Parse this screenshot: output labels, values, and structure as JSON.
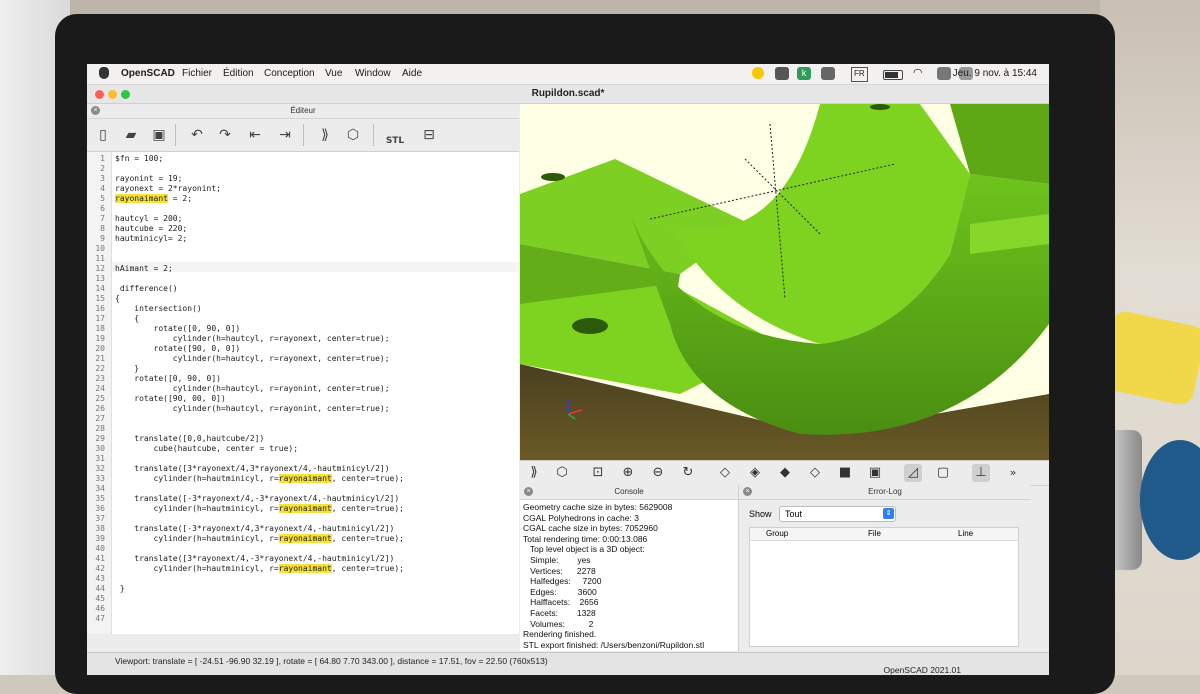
{
  "menubar": {
    "app_name": "OpenSCAD",
    "menus": [
      "Fichier",
      "Édition",
      "Conception",
      "Vue",
      "Window",
      "Aide"
    ],
    "input_source": "FR",
    "clock": "Jeu. 9 nov. à 15:44",
    "tray_icon_k": "k"
  },
  "window": {
    "title": "Rupildon.scad*"
  },
  "editor": {
    "panel_title": "Éditeur",
    "toolbar": {
      "new_icon": "new-file-icon",
      "open_icon": "folder-icon",
      "save_icon": "save-icon",
      "undo_icon": "undo-icon",
      "redo_icon": "redo-icon",
      "unindent_icon": "unindent-icon",
      "indent_icon": "indent-icon",
      "preview_icon": "preview-icon",
      "render_icon": "render-icon",
      "stl_label": "STL",
      "export_icon": "export-icon"
    },
    "lines": [
      {
        "n": "1",
        "text": "$fn = 100;"
      },
      {
        "n": "2",
        "text": ""
      },
      {
        "n": "3",
        "text": "rayonint = 19;"
      },
      {
        "n": "4",
        "text": "rayonext = 2*rayonint;"
      },
      {
        "n": "5",
        "text": "rayonaimant = 2;",
        "hl": "rayonaimant"
      },
      {
        "n": "6",
        "text": ""
      },
      {
        "n": "7",
        "text": "hautcyl = 200;"
      },
      {
        "n": "8",
        "text": "hautcube = 220;"
      },
      {
        "n": "9",
        "text": "hautminicyl= 2;"
      },
      {
        "n": "10",
        "text": ""
      },
      {
        "n": "11",
        "text": ""
      },
      {
        "n": "12",
        "text": "hAimant = 2;"
      },
      {
        "n": "13",
        "text": ""
      },
      {
        "n": "14",
        "text": " difference()"
      },
      {
        "n": "15",
        "text": "{"
      },
      {
        "n": "16",
        "text": "    intersection()"
      },
      {
        "n": "17",
        "text": "    {"
      },
      {
        "n": "18",
        "text": "        rotate([0, 90, 0])"
      },
      {
        "n": "19",
        "text": "            cylinder(h=hautcyl, r=rayonext, center=true);"
      },
      {
        "n": "20",
        "text": "        rotate([90, 0, 0])"
      },
      {
        "n": "21",
        "text": "            cylinder(h=hautcyl, r=rayonext, center=true);"
      },
      {
        "n": "22",
        "text": "    }"
      },
      {
        "n": "23",
        "text": "    rotate([0, 90, 0])"
      },
      {
        "n": "24",
        "text": "            cylinder(h=hautcyl, r=rayonint, center=true);"
      },
      {
        "n": "25",
        "text": "    rotate([90, 00, 0])"
      },
      {
        "n": "26",
        "text": "            cylinder(h=hautcyl, r=rayonint, center=true);"
      },
      {
        "n": "27",
        "text": ""
      },
      {
        "n": "28",
        "text": ""
      },
      {
        "n": "29",
        "text": "    translate([0,0,hautcube/2])"
      },
      {
        "n": "30",
        "text": "        cube(hautcube, center = true);"
      },
      {
        "n": "31",
        "text": ""
      },
      {
        "n": "32",
        "text": "    translate([3*rayonext/4,3*rayonext/4,-hautminicyl/2])"
      },
      {
        "n": "33",
        "text": "        cylinder(h=hautminicyl, r=rayonaimant, center=true);",
        "hl": "rayonaimant"
      },
      {
        "n": "34",
        "text": ""
      },
      {
        "n": "35",
        "text": "    translate([-3*rayonext/4,-3*rayonext/4,-hautminicyl/2])"
      },
      {
        "n": "36",
        "text": "        cylinder(h=hautminicyl, r=rayonaimant, center=true);",
        "hl": "rayonaimant"
      },
      {
        "n": "37",
        "text": ""
      },
      {
        "n": "38",
        "text": "    translate([-3*rayonext/4,3*rayonext/4,-hautminicyl/2])"
      },
      {
        "n": "39",
        "text": "        cylinder(h=hautminicyl, r=rayonaimant, center=true);",
        "hl": "rayonaimant"
      },
      {
        "n": "40",
        "text": ""
      },
      {
        "n": "41",
        "text": "    translate([3*rayonext/4,-3*rayonext/4,-hautminicyl/2])"
      },
      {
        "n": "42",
        "text": "        cylinder(h=hautminicyl, r=rayonaimant, center=true);",
        "hl": "rayonaimant"
      },
      {
        "n": "43",
        "text": ""
      },
      {
        "n": "44",
        "text": " }"
      },
      {
        "n": "45",
        "text": ""
      },
      {
        "n": "46",
        "text": ""
      },
      {
        "n": "47",
        "text": ""
      }
    ]
  },
  "viewport": {
    "model_color": "#7ed321",
    "background_color": "#ffffe5",
    "toolbar_icons": [
      "render-icon",
      "preview-icon",
      "zoom-all-icon",
      "zoom-in-icon",
      "zoom-out-icon",
      "reset-view-icon",
      "view-right-icon",
      "view-top-icon",
      "view-bottom-icon",
      "view-left-icon",
      "view-front-icon",
      "view-back-icon",
      "perspective-icon",
      "orthogonal-icon",
      "axes-icon",
      "more-icon"
    ]
  },
  "console": {
    "panel_title": "Console",
    "lines": [
      "Geometry cache size in bytes: 5629008",
      "CGAL Polyhedrons in cache: 3",
      "CGAL cache size in bytes: 7052960",
      "Total rendering time: 0:00:13.086",
      "   Top level object is a 3D object:",
      "   Simple:        yes",
      "   Vertices:      2278",
      "   Halfedges:     7200",
      "   Edges:         3600",
      "   Halffacets:    2656",
      "   Facets:        1328",
      "   Volumes:          2",
      "Rendering finished.",
      "STL export finished: /Users/benzoni/Rupildon.stl"
    ]
  },
  "errorlog": {
    "panel_title": "Error-Log",
    "show_label": "Show",
    "filter_value": "Tout",
    "columns": [
      "Group",
      "File",
      "Line"
    ]
  },
  "statusbar": {
    "viewport_info": "Viewport: translate = [ -24.51 -96.90 32.19 ], rotate = [ 64.80 7.70 343.00 ], distance = 17.51, fov = 22.50 (760x513)",
    "version": "OpenSCAD 2021.01"
  }
}
